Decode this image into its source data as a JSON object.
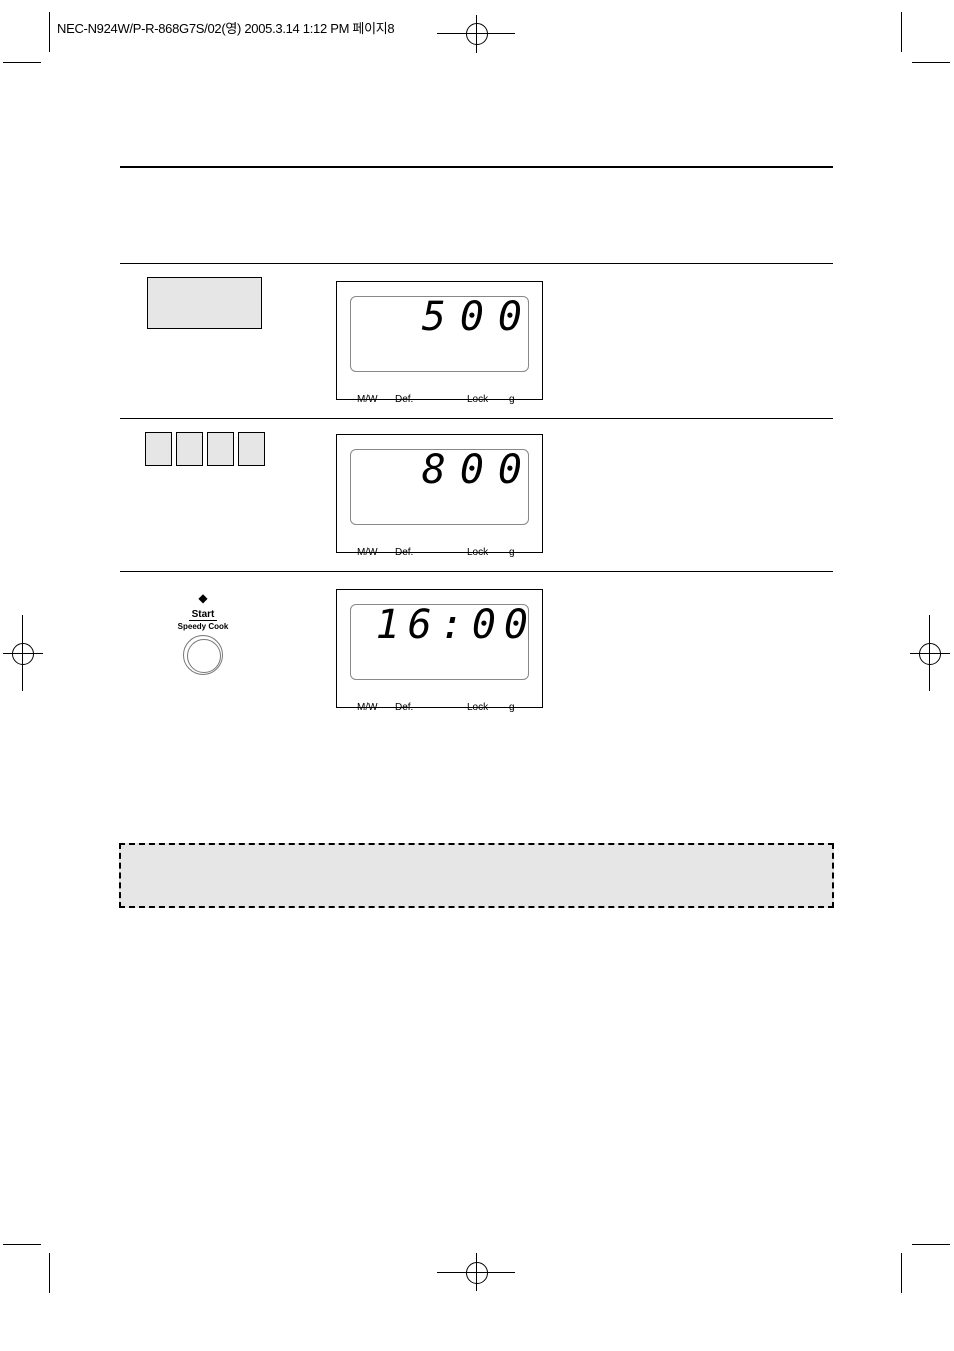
{
  "header": {
    "slug": "NEC-N924W/P-R-868G7S/02(영) 2005.3.14 1:12 PM 페이지8"
  },
  "steps": [
    {
      "display": "500",
      "labels": {
        "mw": "M/W",
        "def": "Def.",
        "lock": "Lock",
        "g": "g"
      }
    },
    {
      "display": "800",
      "labels": {
        "mw": "M/W",
        "def": "Def.",
        "lock": "Lock",
        "g": "g"
      }
    },
    {
      "display": "16:00",
      "labels": {
        "mw": "M/W",
        "def": "Def.",
        "lock": "Lock",
        "g": "g"
      }
    }
  ],
  "start_button": {
    "label": "Start",
    "sublabel": "Speedy Cook",
    "icon": "start-diamond-icon"
  }
}
